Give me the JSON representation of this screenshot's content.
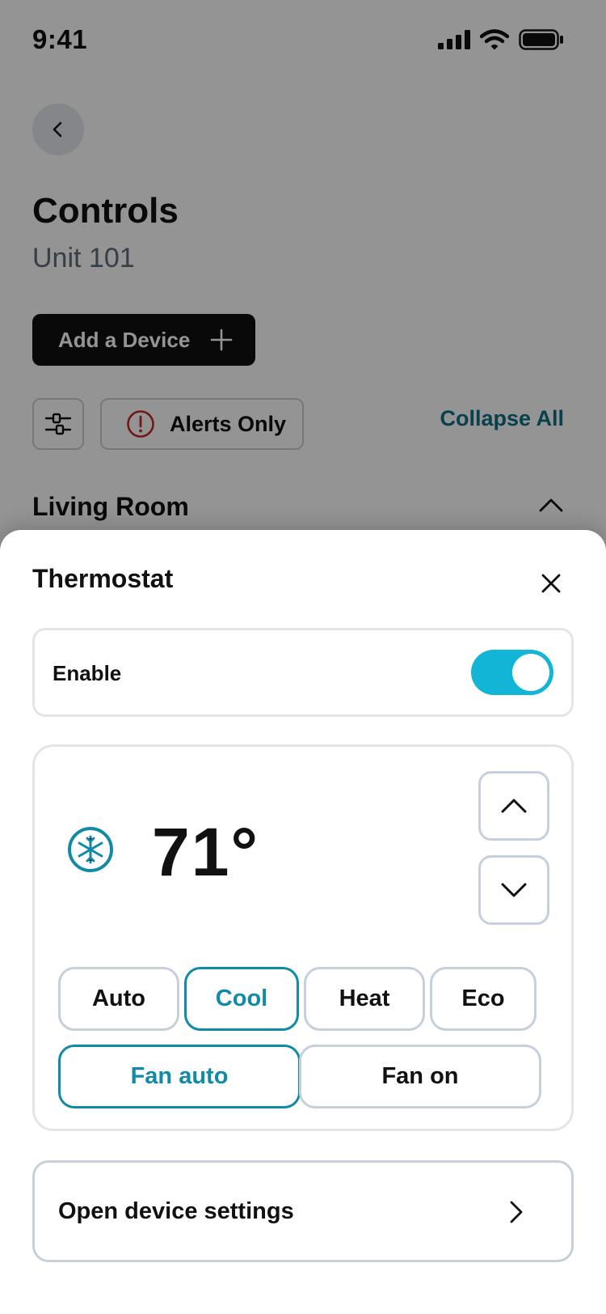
{
  "status_bar": {
    "time": "9:41"
  },
  "page": {
    "title": "Controls",
    "subtitle": "Unit 101",
    "add_device_label": "Add a Device",
    "alerts_label": "Alerts Only",
    "collapse_all_label": "Collapse All",
    "section_title": "Living Room"
  },
  "sheet": {
    "title": "Thermostat",
    "enable_label": "Enable",
    "enabled": true,
    "temperature": "71°",
    "modes": [
      "Auto",
      "Cool",
      "Heat",
      "Eco"
    ],
    "selected_mode": "Cool",
    "fan_modes": [
      "Fan auto",
      "Fan on"
    ],
    "selected_fan_mode": "Fan auto",
    "settings_label": "Open device settings"
  },
  "colors": {
    "accent": "#118aa8",
    "toggle_on": "#13b5d6",
    "link": "#0e6f86",
    "alert": "#c62828"
  },
  "icons": {
    "back": "chevron-left-icon",
    "add": "plus-icon",
    "filter": "sliders-icon",
    "alert": "alert-circle-icon",
    "collapse": "chevron-up-icon",
    "close": "close-icon",
    "mode": "snowflake-icon",
    "increase": "chevron-up-icon",
    "decrease": "chevron-down-icon",
    "settings": "chevron-right-icon"
  }
}
